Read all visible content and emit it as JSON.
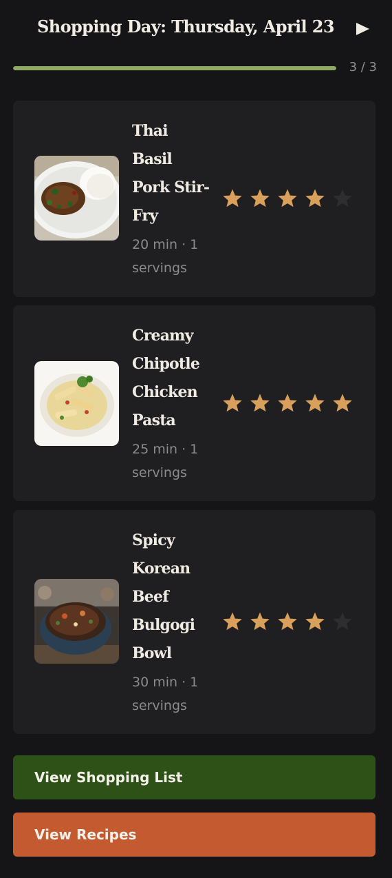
{
  "header": {
    "title": "Shopping Day: Thursday, April 23",
    "play_icon": "play-icon"
  },
  "progress": {
    "current": 3,
    "total": 3,
    "fraction": 1.0,
    "label": "3 / 3",
    "color": "#8fa866"
  },
  "recipes": [
    {
      "name": "Thai Basil Pork Stir-Fry",
      "meta": "20 min · 1 servings",
      "rating": 4,
      "max_rating": 5,
      "image_icon": "thai-basil-pork-image"
    },
    {
      "name": "Creamy Chipotle Chicken Pasta",
      "meta": "25 min · 1 servings",
      "rating": 5,
      "max_rating": 5,
      "image_icon": "chipotle-pasta-image"
    },
    {
      "name": "Spicy Korean Beef Bulgogi Bowl",
      "meta": "30 min · 1 servings",
      "rating": 4,
      "max_rating": 5,
      "image_icon": "bulgogi-bowl-image"
    }
  ],
  "actions": {
    "shopping_list_label": "View Shopping List",
    "recipes_label": "View Recipes"
  },
  "colors": {
    "background": "#151517",
    "card": "#1f1f21",
    "star_filled": "#d9a05b",
    "star_empty": "#2e2e31",
    "shopping_button": "#2e5118",
    "recipes_button": "#c45a30"
  }
}
